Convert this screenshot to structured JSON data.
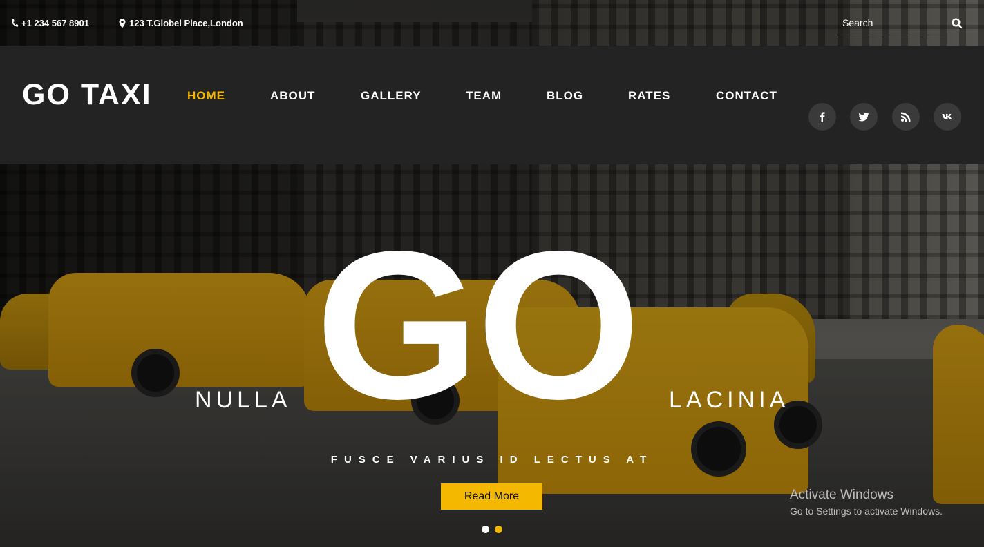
{
  "topbar": {
    "phone": "+1 234 567 8901",
    "address": "123 T.Globel Place,London",
    "search_placeholder": "Search"
  },
  "header": {
    "logo": "GO TAXI",
    "nav": [
      "HOME",
      "ABOUT",
      "GALLERY",
      "TEAM",
      "BLOG",
      "RATES",
      "CONTACT"
    ],
    "active_nav": "HOME",
    "social_icons": [
      "facebook-icon",
      "twitter-icon",
      "rss-icon",
      "vk-icon"
    ]
  },
  "hero": {
    "big_word": "GO",
    "left_word": "NULLA",
    "right_word": "LACINIA",
    "subtitle": "FUSCE VARIUS ID LECTUS AT",
    "button": "Read More",
    "slide_count": 2,
    "active_slide": 2
  },
  "os_watermark": {
    "title": "Activate Windows",
    "subtitle": "Go to Settings to activate Windows."
  },
  "colors": {
    "accent": "#f5b800",
    "header_bg": "#232323",
    "text": "#ffffff"
  }
}
